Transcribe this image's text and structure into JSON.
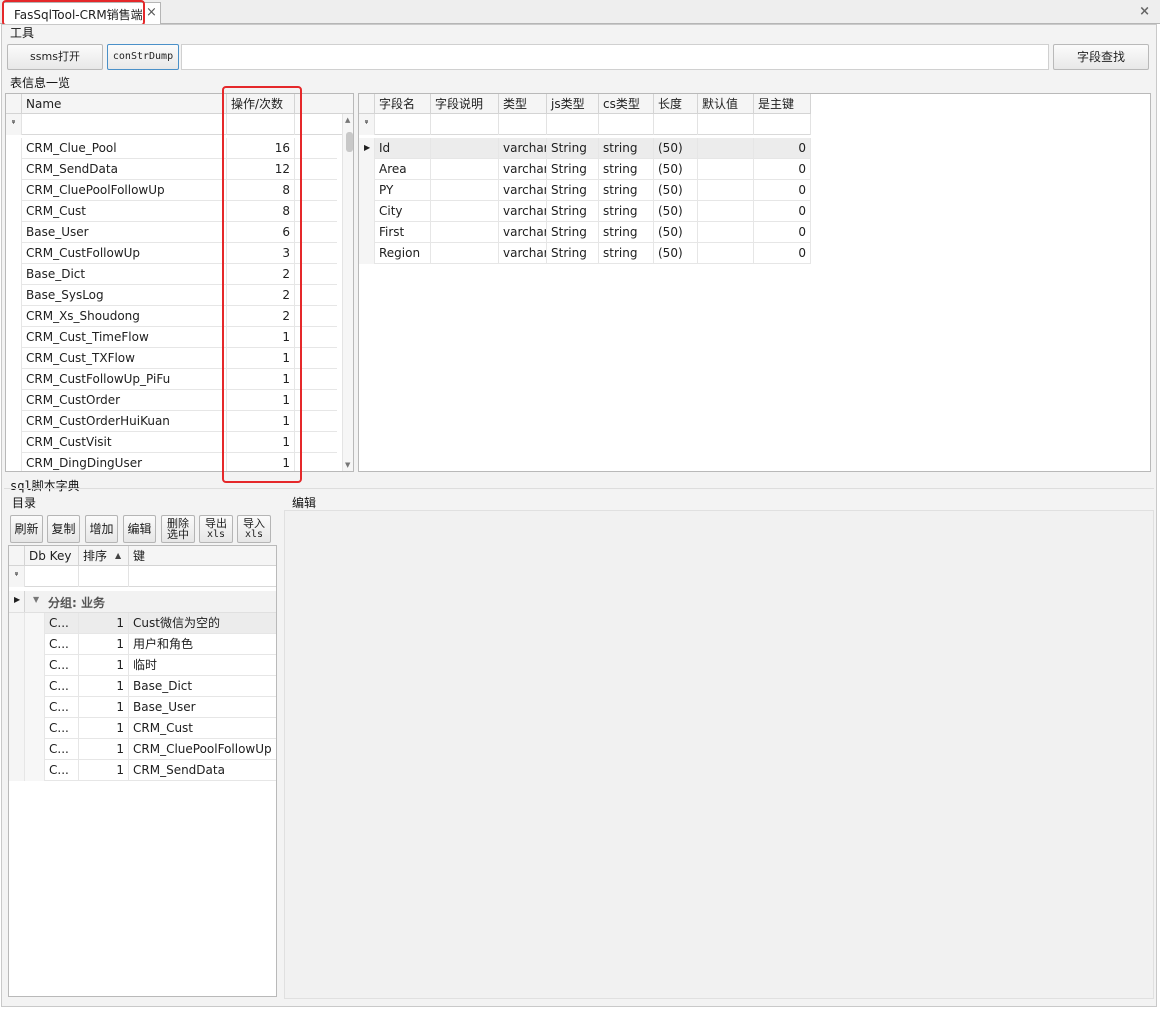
{
  "tab": {
    "title": "FasSqlTool-CRM销售端",
    "close": "×"
  },
  "window": {
    "close": "×"
  },
  "tools": {
    "group": "工具",
    "btn1": "ssms打开",
    "btn2": "conStrDump",
    "btn3": "字段查找",
    "input_value": ""
  },
  "table_info": {
    "group": "表信息一览",
    "headers": {
      "name": "Name",
      "count": "操作/次数"
    },
    "rows": [
      {
        "name": "CRM_Clue_Pool",
        "count": "16"
      },
      {
        "name": "CRM_SendData",
        "count": "12"
      },
      {
        "name": "CRM_CluePoolFollowUp",
        "count": "8"
      },
      {
        "name": "CRM_Cust",
        "count": "8"
      },
      {
        "name": "Base_User",
        "count": "6"
      },
      {
        "name": "CRM_CustFollowUp",
        "count": "3"
      },
      {
        "name": "Base_Dict",
        "count": "2"
      },
      {
        "name": "Base_SysLog",
        "count": "2"
      },
      {
        "name": "CRM_Xs_Shoudong",
        "count": "2"
      },
      {
        "name": "CRM_Cust_TimeFlow",
        "count": "1"
      },
      {
        "name": "CRM_Cust_TXFlow",
        "count": "1"
      },
      {
        "name": "CRM_CustFollowUp_PiFu",
        "count": "1"
      },
      {
        "name": "CRM_CustOrder",
        "count": "1"
      },
      {
        "name": "CRM_CustOrderHuiKuan",
        "count": "1"
      },
      {
        "name": "CRM_CustVisit",
        "count": "1"
      },
      {
        "name": "CRM_DingDingUser",
        "count": "1"
      }
    ]
  },
  "fields": {
    "headers": [
      "字段名",
      "字段说明",
      "类型",
      "js类型",
      "cs类型",
      "长度",
      "默认值",
      "是主键"
    ],
    "rows": [
      {
        "name": "Id",
        "desc": "",
        "type": "varchar",
        "js": "String",
        "cs": "string",
        "len": "(50)",
        "def": "",
        "pk": "0"
      },
      {
        "name": "Area",
        "desc": "",
        "type": "varchar",
        "js": "String",
        "cs": "string",
        "len": "(50)",
        "def": "",
        "pk": "0"
      },
      {
        "name": "PY",
        "desc": "",
        "type": "varchar",
        "js": "String",
        "cs": "string",
        "len": "(50)",
        "def": "",
        "pk": "0"
      },
      {
        "name": "City",
        "desc": "",
        "type": "varchar",
        "js": "String",
        "cs": "string",
        "len": "(50)",
        "def": "",
        "pk": "0"
      },
      {
        "name": "First",
        "desc": "",
        "type": "varchar",
        "js": "String",
        "cs": "string",
        "len": "(50)",
        "def": "",
        "pk": "0"
      },
      {
        "name": "Region",
        "desc": "",
        "type": "varchar",
        "js": "String",
        "cs": "string",
        "len": "(50)",
        "def": "",
        "pk": "0"
      }
    ]
  },
  "sql_dict": {
    "group": "sql脚本字典",
    "catalog_label": "目录",
    "edit_label": "编辑",
    "toolbar": {
      "refresh": "刷新",
      "copy": "复制",
      "add": "增加",
      "edit": "编辑",
      "delete_l1": "删除",
      "delete_l2": "选中",
      "export_l1": "导出",
      "export_l2": "xls",
      "import_l1": "导入",
      "import_l2": "xls"
    },
    "headers": {
      "dbkey": "Db Key",
      "order": "排序",
      "key": "键",
      "sort_icon": "▲"
    },
    "group_row": "分组: 业务",
    "rows": [
      {
        "dbkey": "C...",
        "order": "1",
        "key": "Cust微信为空的"
      },
      {
        "dbkey": "C...",
        "order": "1",
        "key": "用户和角色"
      },
      {
        "dbkey": "C...",
        "order": "1",
        "key": "临时"
      },
      {
        "dbkey": "C...",
        "order": "1",
        "key": "Base_Dict"
      },
      {
        "dbkey": "C...",
        "order": "1",
        "key": "Base_User"
      },
      {
        "dbkey": "C...",
        "order": "1",
        "key": "CRM_Cust"
      },
      {
        "dbkey": "C...",
        "order": "1",
        "key": "CRM_CluePoolFollowUp"
      },
      {
        "dbkey": "C...",
        "order": "1",
        "key": "CRM_SendData"
      }
    ]
  },
  "colors": {
    "highlight": "#e5282a",
    "focus_border": "#4a90c8"
  }
}
